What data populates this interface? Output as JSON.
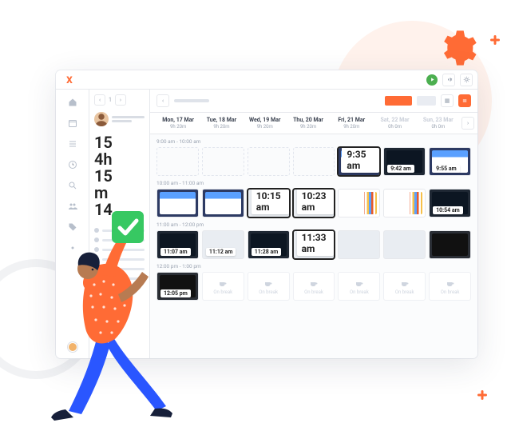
{
  "brand": {
    "mark": "X"
  },
  "topbar": {
    "play": "play",
    "settings": "settings",
    "sun": "brightness"
  },
  "side": {
    "page": "1",
    "stats": [
      {
        "v": "15"
      },
      {
        "v": "4h"
      },
      {
        "v": "15"
      },
      {
        "v": "m"
      },
      {
        "v": "14"
      }
    ]
  },
  "days": [
    {
      "label": "Mon, 17 Mar",
      "hours": "9h 20m"
    },
    {
      "label": "Tue, 18 Mar",
      "hours": "9h 20m"
    },
    {
      "label": "Wed, 19 Mar",
      "hours": "9h 20m"
    },
    {
      "label": "Thu, 20 Mar",
      "hours": "9h 20m"
    },
    {
      "label": "Fri, 21 Mar",
      "hours": "9h 20m"
    },
    {
      "label": "Sat, 22 Mar",
      "hours": "0h 0m",
      "dim": true
    },
    {
      "label": "Sun, 23 Mar",
      "hours": "0h 0m",
      "dim": true
    }
  ],
  "blocks": [
    {
      "label": "9:00 am - 10:00 am",
      "thumbs": [
        {
          "type": "empty"
        },
        {
          "type": "empty"
        },
        {
          "type": "empty"
        },
        {
          "type": "empty"
        },
        {
          "type": "blue",
          "time": "9:35 am",
          "hl": true
        },
        {
          "type": "dark",
          "time": "9:42 am"
        },
        {
          "type": "blue",
          "time": "9:55 am"
        }
      ]
    },
    {
      "label": "10:00 am - 11:00 am",
      "thumbs": [
        {
          "type": "blue",
          "time": ""
        },
        {
          "type": "blue",
          "time": ""
        },
        {
          "type": "plain",
          "time": "10:15 am",
          "hl": true
        },
        {
          "type": "plain",
          "time": "10:23 am",
          "hl": true
        },
        {
          "type": "color",
          "time": ""
        },
        {
          "type": "color",
          "time": ""
        },
        {
          "type": "dark",
          "time": "10:54 am"
        }
      ]
    },
    {
      "label": "11:00 am - 12:00 pm",
      "thumbs": [
        {
          "type": "dark",
          "time": "11:07 am"
        },
        {
          "type": "plain",
          "time": "11:12 am"
        },
        {
          "type": "dark",
          "time": "11:28 am"
        },
        {
          "type": "plain",
          "time": "11:33 am",
          "hl": true
        },
        {
          "type": "plain",
          "time": ""
        },
        {
          "type": "plain",
          "time": ""
        },
        {
          "type": "vc",
          "time": ""
        }
      ]
    },
    {
      "label": "12:00 pm - 1:00 pm",
      "thumbs": [
        {
          "type": "vc",
          "time": "12:05 pm"
        },
        {
          "type": "break",
          "text": "On break"
        },
        {
          "type": "break",
          "text": "On break"
        },
        {
          "type": "break",
          "text": "On break"
        },
        {
          "type": "break",
          "text": "On break"
        },
        {
          "type": "break",
          "text": "On break"
        },
        {
          "type": "break",
          "text": "On break"
        }
      ]
    }
  ],
  "break_label": "On break"
}
